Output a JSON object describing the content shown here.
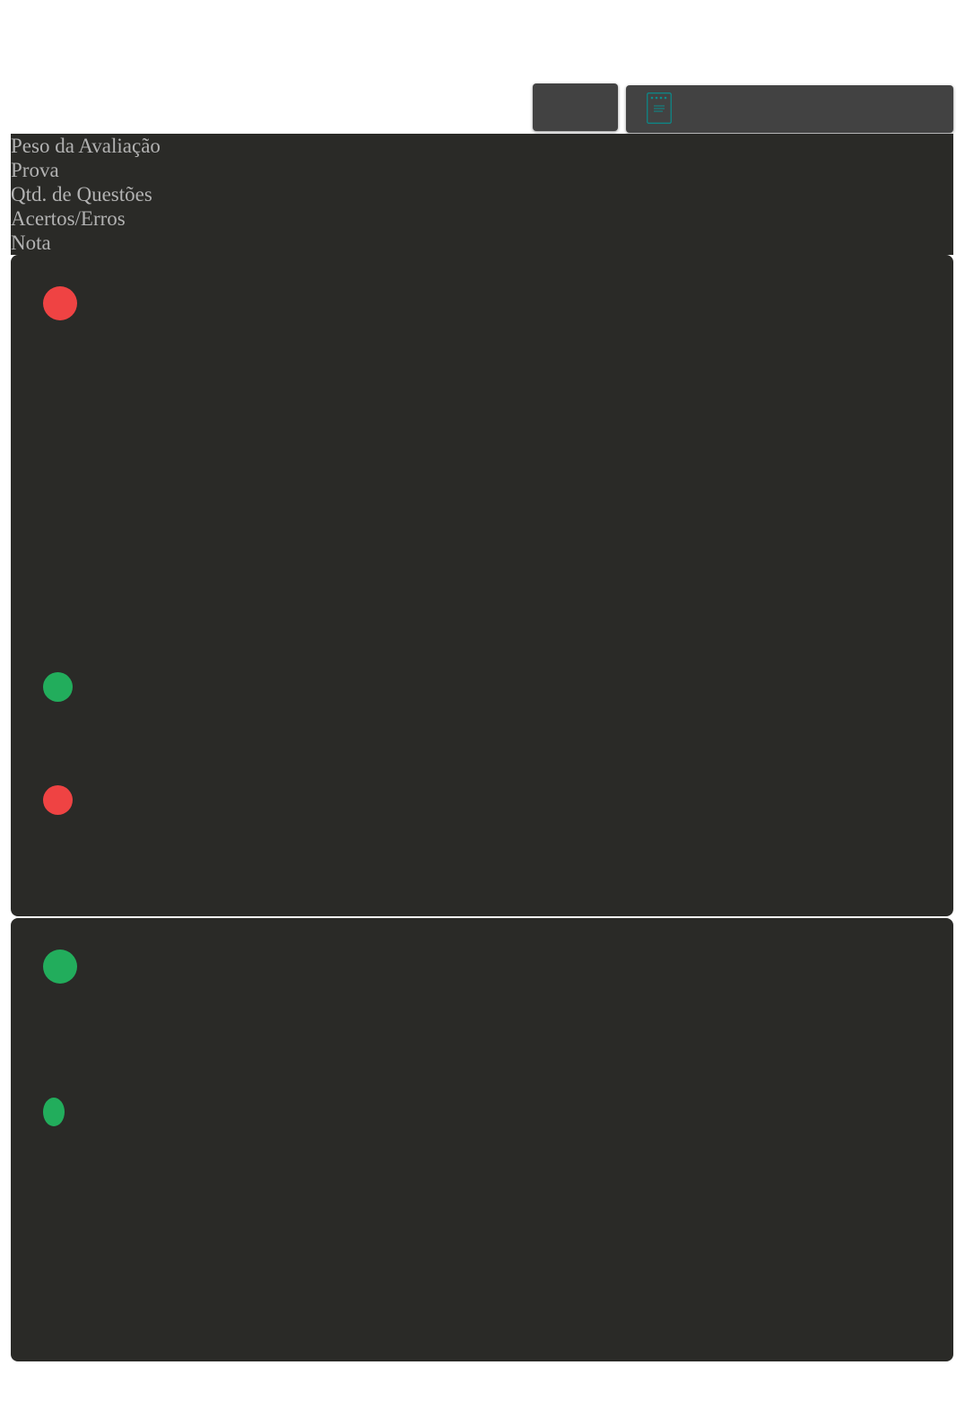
{
  "toolbar": {
    "tab_button_label": "",
    "exam_icon": "exam-sheet-icon",
    "select_label": ""
  },
  "table": {
    "columns": [
      "Peso da Avaliação",
      "Prova",
      "Qtd. de Questões",
      "Acertos/Erros",
      "Nota"
    ]
  },
  "cards": [
    {
      "indicators": [
        {
          "status": "wrong",
          "color": "#ef4343"
        },
        {
          "status": "right",
          "color": "#22ad5c"
        },
        {
          "status": "wrong",
          "color": "#ef4343"
        }
      ]
    },
    {
      "indicators": [
        {
          "status": "right",
          "color": "#22ad5c"
        },
        {
          "status": "right",
          "color": "#22ad5c"
        }
      ]
    }
  ],
  "colors": {
    "panel_bg": "#2a2a27",
    "button_bg": "#424242",
    "header_text": "#b2b2b2",
    "accent_icon": "#0a8c8c",
    "wrong": "#ef4343",
    "right": "#22ad5c"
  }
}
